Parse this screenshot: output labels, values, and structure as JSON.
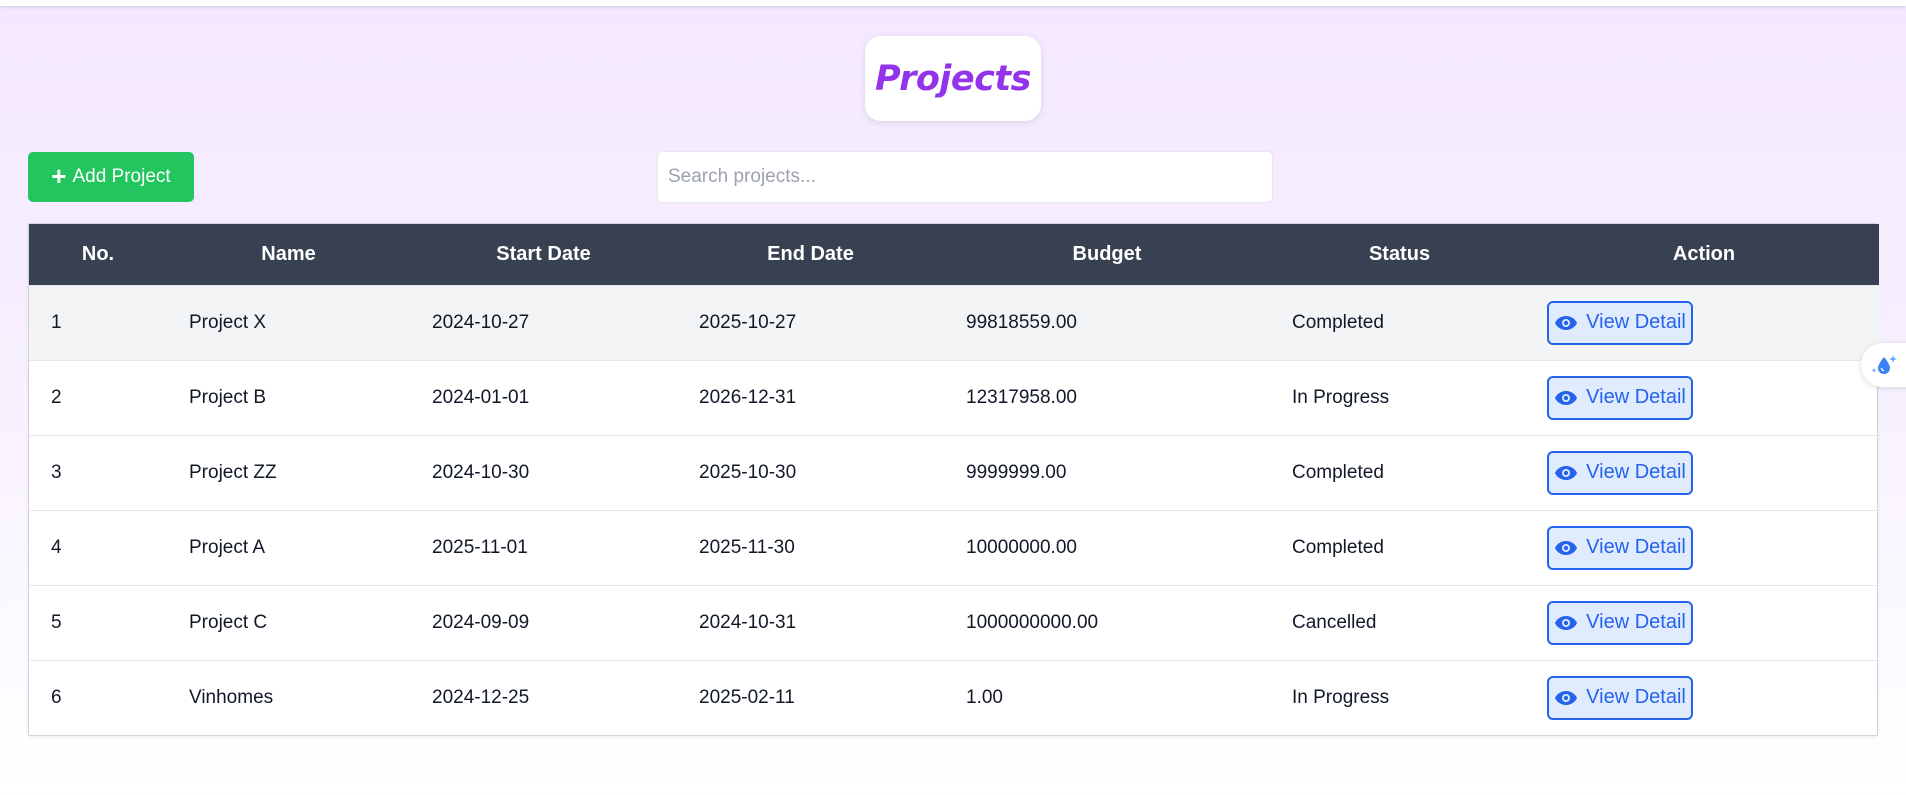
{
  "page": {
    "title": "Projects"
  },
  "toolbar": {
    "add_label": "Add Project",
    "add_icon": "plus-icon",
    "search_placeholder": "Search projects..."
  },
  "table": {
    "columns": [
      "No.",
      "Name",
      "Start Date",
      "End Date",
      "Budget",
      "Status",
      "Action"
    ],
    "action_label": "View Detail",
    "action_icon": "eye-icon",
    "rows": [
      {
        "no": "1",
        "name": "Project X",
        "start": "2024-10-27",
        "end": "2025-10-27",
        "budget": "99818559.00",
        "status": "Completed"
      },
      {
        "no": "2",
        "name": "Project B",
        "start": "2024-01-01",
        "end": "2026-12-31",
        "budget": "12317958.00",
        "status": "In Progress"
      },
      {
        "no": "3",
        "name": "Project ZZ",
        "start": "2024-10-30",
        "end": "2025-10-30",
        "budget": "9999999.00",
        "status": "Completed"
      },
      {
        "no": "4",
        "name": "Project A",
        "start": "2025-11-01",
        "end": "2025-11-30",
        "budget": "10000000.00",
        "status": "Completed"
      },
      {
        "no": "5",
        "name": "Project C",
        "start": "2024-09-09",
        "end": "2024-10-31",
        "budget": "1000000000.00",
        "status": "Cancelled"
      },
      {
        "no": "6",
        "name": "Vinhomes",
        "start": "2024-12-25",
        "end": "2025-02-11",
        "budget": "1.00",
        "status": "In Progress"
      }
    ]
  },
  "floating": {
    "icon": "sparkle-drop-icon"
  },
  "colors": {
    "accent": "#9333ea",
    "add_button": "#22c55e",
    "header_bg": "#374151",
    "action": "#2563eb"
  }
}
